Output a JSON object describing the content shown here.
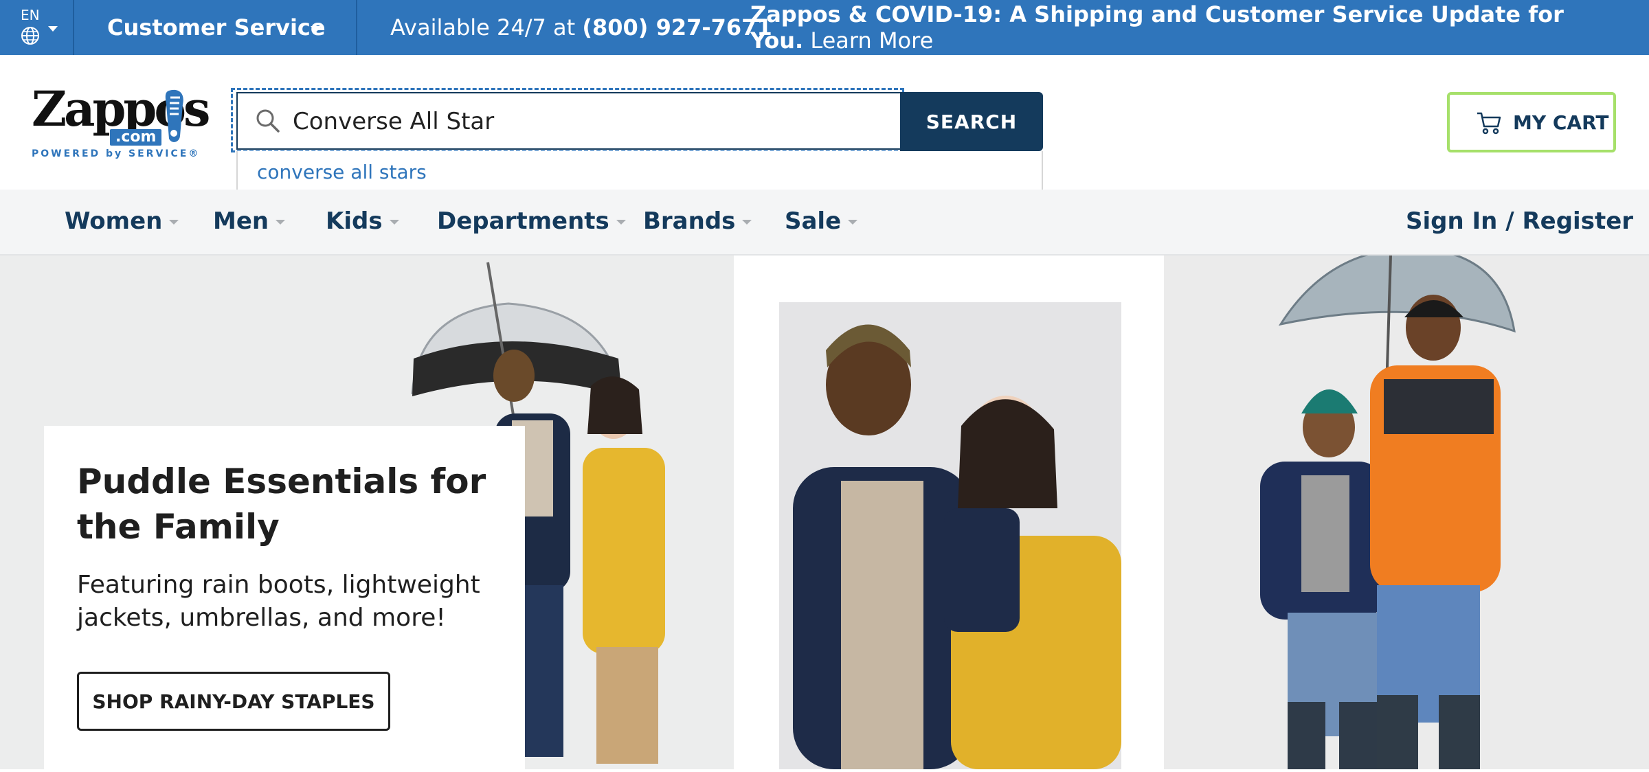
{
  "topbar": {
    "lang_code": "EN",
    "customer_service": "Customer Service",
    "availability_prefix": "Available 24/7 at ",
    "phone": "(800) 927-7671",
    "covid_headline": "Zappos & COVID-19: A Shipping and Customer Service Update for You.",
    "covid_link": " Learn More",
    "bar_color": "#2f75bb"
  },
  "header": {
    "logo_word": "Zappos",
    "logo_dotcom": ".com",
    "logo_tagline": "POWERED by SERVICE®",
    "search_value": "Converse All Star",
    "search_button": "SEARCH",
    "suggestion": "converse all stars",
    "cart_label": "MY CART",
    "cart_border_color": "#a6e06a"
  },
  "nav": {
    "items": [
      "Women",
      "Men",
      "Kids",
      "Departments",
      "Brands",
      "Sale"
    ],
    "signin": "Sign In / Register"
  },
  "promo": {
    "title": "Puddle Essentials for the Family",
    "description": "Featuring rain boots, lightweight jackets, umbrellas, and more!",
    "cta": "SHOP RAINY-DAY STAPLES"
  }
}
